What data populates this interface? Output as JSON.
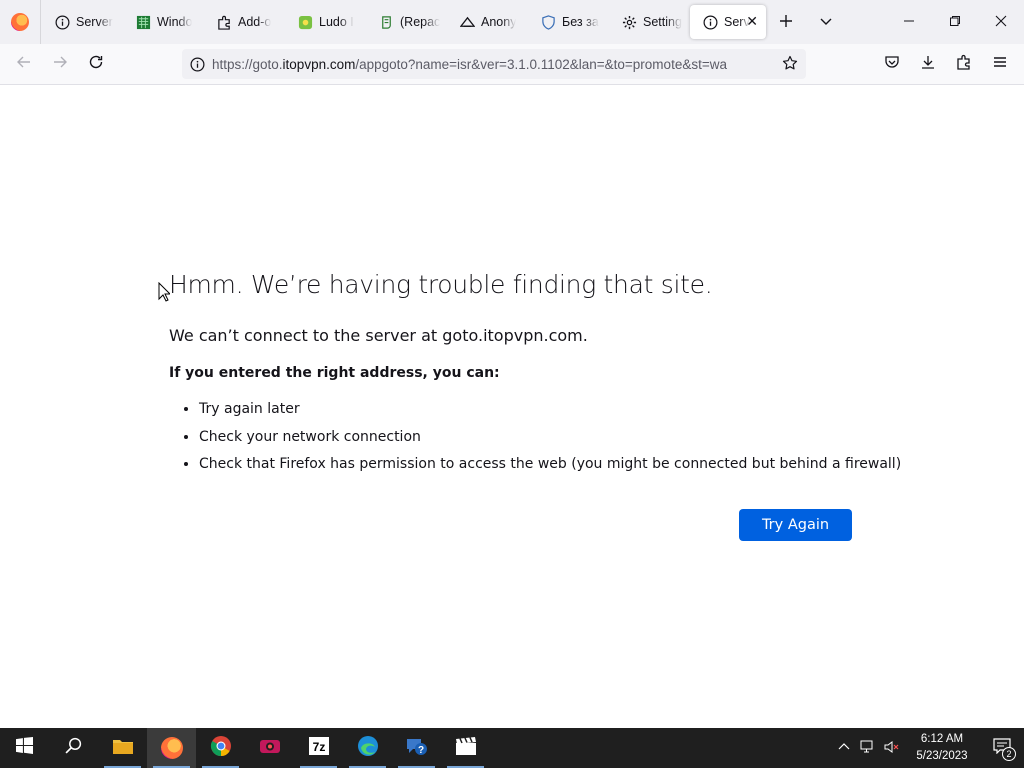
{
  "browser": {
    "tabs": [
      {
        "label": "Server",
        "icon": "info-icon"
      },
      {
        "label": "Windo",
        "icon": "windows-app-icon"
      },
      {
        "label": "Add-o",
        "icon": "puzzle-icon"
      },
      {
        "label": "Ludo I",
        "icon": "ludo-icon"
      },
      {
        "label": "(Repac",
        "icon": "script-icon"
      },
      {
        "label": "Anony",
        "icon": "anonymous-icon"
      },
      {
        "label": "Без за",
        "icon": "shield-icon"
      },
      {
        "label": "Setting",
        "icon": "gear-icon"
      },
      {
        "label": "Serv",
        "icon": "info-icon",
        "active": true
      }
    ],
    "url": {
      "prefix": "https://goto.",
      "domain": "itopvpn.com",
      "rest": "/appgoto?name=isr&ver=3.1.0.1102&lan=&to=promote&st=wa"
    }
  },
  "error_page": {
    "title": "Hmm. We’re having trouble finding that site.",
    "description": "We can’t connect to the server at goto.itopvpn.com.",
    "subtitle": "If you entered the right address, you can:",
    "suggestions": [
      "Try again later",
      "Check your network connection",
      "Check that Firefox has permission to access the web (you might be connected but behind a firewall)"
    ],
    "button_label": "Try Again"
  },
  "taskbar": {
    "time": "6:12 AM",
    "date": "5/23/2023",
    "notification_count": "2",
    "apps": [
      "start-icon",
      "search-icon",
      "file-explorer-icon",
      "firefox-icon",
      "chrome-icon",
      "video-recorder-icon",
      "7zip-icon",
      "edge-icon",
      "help-icon",
      "clapper-icon"
    ]
  },
  "colors": {
    "accent": "#0061e0",
    "tab_strip": "#f0f0f4",
    "taskbar": "#1f1f1f"
  }
}
